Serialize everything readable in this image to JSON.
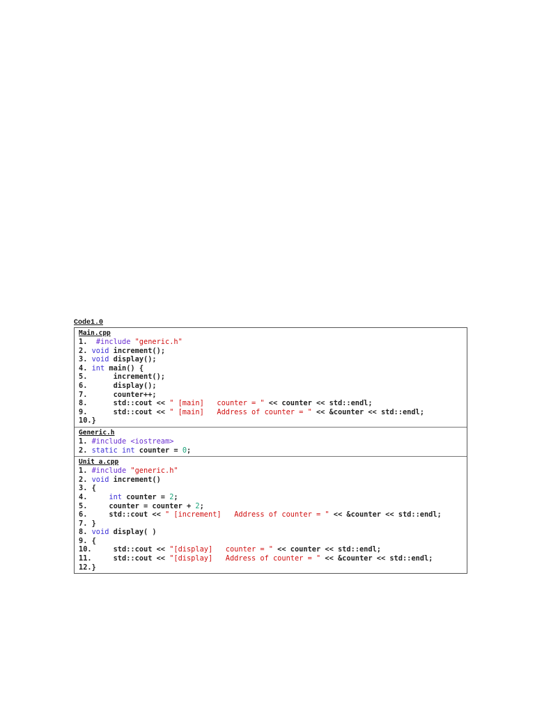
{
  "caption": "Code1.0",
  "colors": {
    "keyword": "#3b2fd6",
    "preprocessor": "#6a2fd0",
    "string": "#d01010",
    "number": "#1aa37a"
  },
  "sections": [
    {
      "title": "Main.cpp",
      "lines": [
        [
          [
            "1.  ",
            "pl"
          ],
          [
            "#include ",
            "pp"
          ],
          [
            "\"generic.h\"",
            "str"
          ]
        ],
        [
          [
            "2. ",
            "pl"
          ],
          [
            "void",
            "kw"
          ],
          [
            " increment();",
            "pl"
          ]
        ],
        [
          [
            "3. ",
            "pl"
          ],
          [
            "void",
            "kw"
          ],
          [
            " display();",
            "pl"
          ]
        ],
        [
          [
            "4. ",
            "pl"
          ],
          [
            "int",
            "kw"
          ],
          [
            " main() {",
            "pl"
          ]
        ],
        [
          [
            "5.      increment();",
            "pl"
          ]
        ],
        [
          [
            "6.      display();",
            "pl"
          ]
        ],
        [
          [
            "7.      counter++;",
            "pl"
          ]
        ],
        [
          [
            "8.      std::cout << ",
            "pl"
          ],
          [
            "\" [main]   counter = \"",
            "str"
          ],
          [
            " << counter << std::endl;",
            "pl"
          ]
        ],
        [
          [
            "9.      std::cout << ",
            "pl"
          ],
          [
            "\" [main]   Address of counter = \"",
            "str"
          ],
          [
            " << &counter << std::endl;",
            "pl"
          ]
        ],
        [
          [
            "10.}",
            "pl"
          ]
        ]
      ]
    },
    {
      "title": "Generic.h",
      "lines": [
        [
          [
            "1. ",
            "pl"
          ],
          [
            "#include <iostream>",
            "pp"
          ]
        ],
        [
          [
            "2. ",
            "pl"
          ],
          [
            "static int",
            "kw"
          ],
          [
            " counter = ",
            "pl"
          ],
          [
            "0",
            "num"
          ],
          [
            ";",
            "pl"
          ]
        ]
      ]
    },
    {
      "title": "Unit a.cpp",
      "lines": [
        [
          [
            "1. ",
            "pl"
          ],
          [
            "#include ",
            "pp"
          ],
          [
            "\"generic.h\"",
            "str"
          ]
        ],
        [
          [
            "2. ",
            "pl"
          ],
          [
            "void",
            "kw"
          ],
          [
            " increment()",
            "pl"
          ]
        ],
        [
          [
            "3. {",
            "pl"
          ]
        ],
        [
          [
            "4.     ",
            "pl"
          ],
          [
            "int",
            "kw"
          ],
          [
            " counter = ",
            "pl"
          ],
          [
            "2",
            "num"
          ],
          [
            ";",
            "pl"
          ]
        ],
        [
          [
            "5.     counter = counter + ",
            "pl"
          ],
          [
            "2",
            "num"
          ],
          [
            ";",
            "pl"
          ]
        ],
        [
          [
            "6.     std::cout << ",
            "pl"
          ],
          [
            "\" [increment]   Address of counter = \"",
            "str"
          ],
          [
            " << &counter << std::endl;",
            "pl"
          ]
        ],
        [
          [
            "7. }",
            "pl"
          ]
        ],
        [
          [
            "8. ",
            "pl"
          ],
          [
            "void",
            "kw"
          ],
          [
            " display( )",
            "pl"
          ]
        ],
        [
          [
            "9. {",
            "pl"
          ]
        ],
        [
          [
            "10.     std::cout << ",
            "pl"
          ],
          [
            "\"[display]   counter = \"",
            "str"
          ],
          [
            " << counter << std::endl;",
            "pl"
          ]
        ],
        [
          [
            "11.     std::cout << ",
            "pl"
          ],
          [
            "\"[display]   Address of counter = \"",
            "str"
          ],
          [
            " << &counter << std::endl;",
            "pl"
          ]
        ],
        [
          [
            "12.}",
            "pl"
          ]
        ]
      ]
    }
  ]
}
